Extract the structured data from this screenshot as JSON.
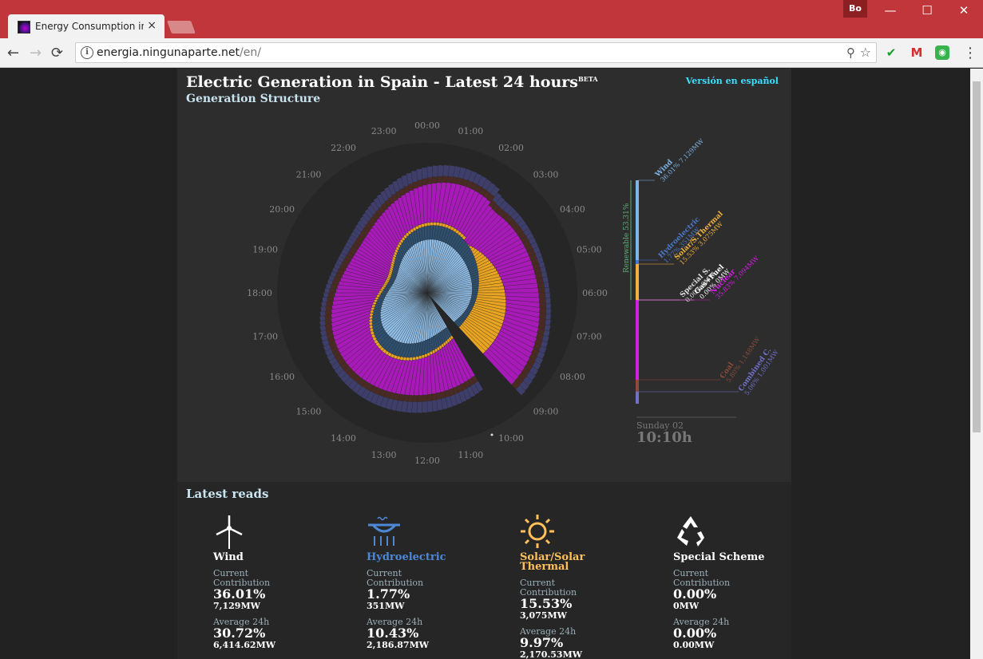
{
  "browser": {
    "tab_title": "Energy Consumption in S",
    "tab_close": "×",
    "profile": "Bo",
    "url_host": "energia.ningunaparte.net",
    "url_path": "/en/",
    "window_buttons": {
      "minimize": "—",
      "maximize": "☐",
      "close": "✕"
    },
    "nav": {
      "back": "←",
      "forward": "→",
      "reload": "⟳",
      "menu": "⋮"
    }
  },
  "page": {
    "title": "Electric Generation in Spain - Latest 24 hours",
    "beta": "BETA",
    "subtitle": "Generation Structure",
    "language_link": "Versión en español",
    "hour_labels": [
      "00:00",
      "01:00",
      "02:00",
      "03:00",
      "04:00",
      "05:00",
      "06:00",
      "07:00",
      "08:00",
      "09:00",
      "10:00",
      "11:00",
      "12:00",
      "13:00",
      "14:00",
      "15:00",
      "16:00",
      "17:00",
      "18:00",
      "19:00",
      "20:00",
      "21:00",
      "22:00",
      "23:00"
    ],
    "date_label": "Sunday 02",
    "time_label": "10:10h"
  },
  "legend": {
    "group": "Renewable 53.31%",
    "items": [
      {
        "name": "Wind",
        "value": "36.01% 7,129MW",
        "color": "#7fb4e6"
      },
      {
        "name": "Hydroelectric",
        "value": "1.77% 351MW",
        "color": "#4a78c9"
      },
      {
        "name": "Solar/S.Thermal",
        "value": "15.53% 3,075MW",
        "color": "#f0b23c"
      },
      {
        "name": "Special S.",
        "value": "0.00% 0MW",
        "color": "#dddddd"
      },
      {
        "name": "Gas+Fuel",
        "value": "0.00% 0MW",
        "color": "#ffffff"
      },
      {
        "name": "Nuclear",
        "value": "35.83% 7,094MW",
        "color": "#d41fe0"
      },
      {
        "name": "Coal",
        "value": "5.80% 1,148MW",
        "color": "#8a4b3c"
      },
      {
        "name": "Combined C.",
        "value": "5.06% 1,001MW",
        "color": "#7070c8"
      }
    ]
  },
  "reads": {
    "title": "Latest reads",
    "current_label": "Current Contribution",
    "average_label": "Average 24h",
    "items": [
      {
        "name": "Wind",
        "icon": "wind-turbine-icon",
        "color": "#ffffff",
        "current_pct": "36.01%",
        "current_mw": "7,129MW",
        "avg_pct": "30.72%",
        "avg_mw": "6,414.62MW"
      },
      {
        "name": "Hydroelectric",
        "icon": "hydro-dam-icon",
        "color": "#4d88d6",
        "current_pct": "1.77%",
        "current_mw": "351MW",
        "avg_pct": "10.43%",
        "avg_mw": "2,186.87MW"
      },
      {
        "name": "Solar/Solar Thermal",
        "icon": "sun-icon",
        "color": "#ffc05c",
        "current_pct": "15.53%",
        "current_mw": "3,075MW",
        "avg_pct": "9.97%",
        "avg_mw": "2,170.53MW"
      },
      {
        "name": "Special Scheme",
        "icon": "recycle-icon",
        "color": "#ffffff",
        "current_pct": "0.00%",
        "current_mw": "0MW",
        "avg_pct": "0.00%",
        "avg_mw": "0.00MW"
      }
    ]
  },
  "colors": {
    "wind": "#8fbde6",
    "hydro": "#2f4f6e",
    "solar": "#e8a321",
    "nuclear": "#a81ab8",
    "coal": "#4a2b24",
    "combined": "#3e3e6b"
  }
}
